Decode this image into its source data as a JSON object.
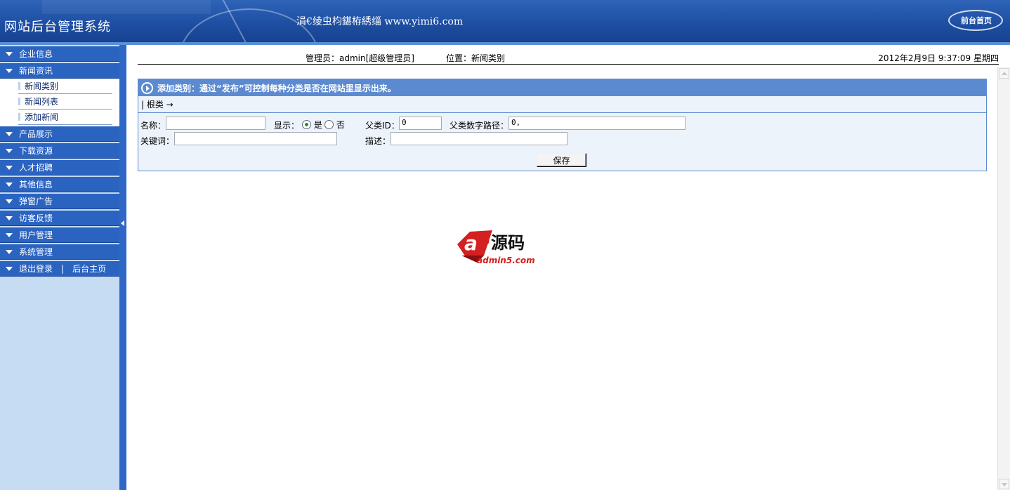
{
  "header": {
    "system_title": "网站后台管理系统",
    "site_title": "涓€绫虫枃鍖栫綉缁 www.yimi6.com",
    "front_home": "前台首页"
  },
  "sidebar": {
    "groups": [
      {
        "label": "企业信息"
      },
      {
        "label": "新闻资讯",
        "items": [
          "新闻类别",
          "新闻列表",
          "添加新闻"
        ]
      },
      {
        "label": "产品展示"
      },
      {
        "label": "下载资源"
      },
      {
        "label": "人才招聘"
      },
      {
        "label": "其他信息"
      },
      {
        "label": "弹窗广告"
      },
      {
        "label": "访客反馈"
      },
      {
        "label": "用户管理"
      },
      {
        "label": "系统管理"
      }
    ],
    "logout": "退出登录",
    "separator": "|",
    "admin_home": "后台主页"
  },
  "info_bar": {
    "admin": "管理员：admin[超级管理员]",
    "position": "位置：新闻类别",
    "datetime": "2012年2月9日 9:37:09 星期四"
  },
  "panel": {
    "title": "添加类别：通过“发布”可控制每种分类是否在网站里显示出来。",
    "breadcrumb": "| 根类 →"
  },
  "form": {
    "name_label": "名称：",
    "name_value": "",
    "show_label": "显示：",
    "show_yes": "是",
    "show_no": "否",
    "show_selected": "是",
    "parent_id_label": "父类ID：",
    "parent_id_value": "0",
    "parent_path_label": "父类数字路径：",
    "parent_path_value": "0,",
    "keywords_label": "关键词：",
    "keywords_value": "",
    "desc_label": "描述：",
    "desc_value": "",
    "save_label": "保存"
  },
  "logo": {
    "brand": "源码",
    "domain": "admin5.com"
  },
  "colors": {
    "header_blue": "#1e4fa3",
    "sidebar_bg": "#c6dcf3",
    "menu_head": "#2b63c0",
    "panel_border": "#5b8ad1",
    "logo_red": "#d42020"
  }
}
